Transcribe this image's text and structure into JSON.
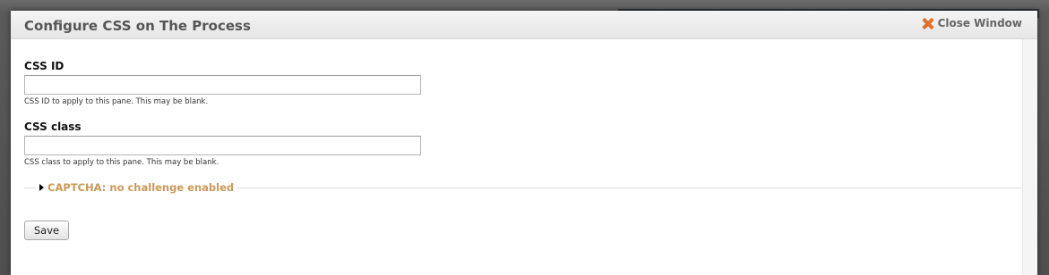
{
  "modal": {
    "title": "Configure CSS on The Process",
    "close_label": "Close Window"
  },
  "form": {
    "css_id": {
      "label": "CSS ID",
      "value": "",
      "help": "CSS ID to apply to this pane. This may be blank."
    },
    "css_class": {
      "label": "CSS class",
      "value": "",
      "help": "CSS class to apply to this pane. This may be blank."
    },
    "captcha": {
      "legend": "CAPTCHA: no challenge enabled"
    },
    "save_label": "Save"
  },
  "colors": {
    "accent_close": "#e0712b",
    "legend_text": "#c9985a"
  },
  "icons": {
    "close": "close-icon",
    "collapse": "triangle-right-icon"
  }
}
